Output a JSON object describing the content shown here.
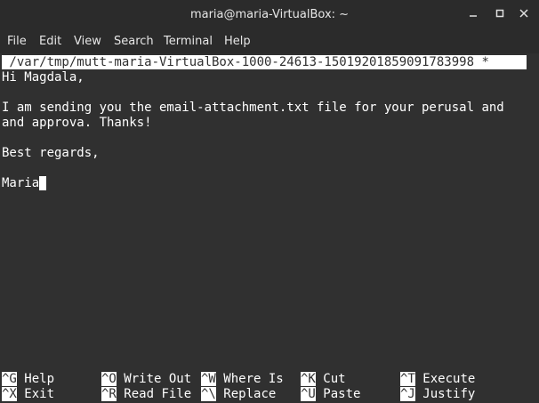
{
  "window": {
    "title": "maria@maria-VirtualBox: ~",
    "min_icon": "minimize-icon",
    "max_icon": "maximize-icon",
    "close_icon": "close-icon"
  },
  "menu": [
    "File",
    "Edit",
    "View",
    "Search",
    "Terminal",
    "Help"
  ],
  "editor": {
    "header": " /var/tmp/mutt-maria-VirtualBox-1000-24613-15019201859091783998 *",
    "lines": [
      "Hi Magdala,",
      "",
      "I am sending you the email-attachment.txt file for your perusal and",
      "and approva. Thanks!",
      "",
      "Best regards,",
      "",
      "Maria"
    ]
  },
  "shortcuts": [
    {
      "key": "^G",
      "label": "Help"
    },
    {
      "key": "^O",
      "label": "Write Out"
    },
    {
      "key": "^W",
      "label": "Where Is"
    },
    {
      "key": "^K",
      "label": "Cut"
    },
    {
      "key": "^T",
      "label": "Execute"
    },
    {
      "key": "^X",
      "label": "Exit"
    },
    {
      "key": "^R",
      "label": "Read File"
    },
    {
      "key": "^\\",
      "label": "Replace"
    },
    {
      "key": "^U",
      "label": "Paste"
    },
    {
      "key": "^J",
      "label": "Justify"
    }
  ],
  "colors": {
    "titlebar_bg": "#2b2b2b",
    "terminal_bg": "#303030",
    "terminal_fg": "#ffffff"
  }
}
